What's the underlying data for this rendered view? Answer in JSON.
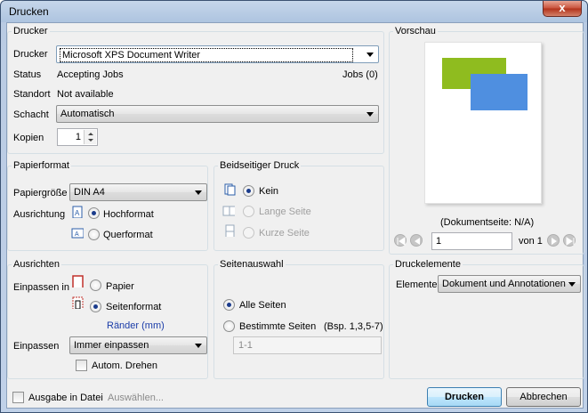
{
  "window": {
    "title": "Drucken",
    "close_label": "x"
  },
  "printer": {
    "group_title": "Drucker",
    "printer_label": "Drucker",
    "printer_value": "Microsoft XPS Document Writer",
    "status_label": "Status",
    "status_value": "Accepting Jobs",
    "jobs_text": "Jobs (0)",
    "location_label": "Standort",
    "location_value": "Not available",
    "tray_label": "Schacht",
    "tray_value": "Automatisch",
    "copies_label": "Kopien",
    "copies_value": "1"
  },
  "paper": {
    "group_title": "Papierformat",
    "size_label": "Papiergröße",
    "size_value": "DIN A4",
    "orientation_label": "Ausrichtung",
    "portrait_label": "Hochformat",
    "landscape_label": "Querformat"
  },
  "duplex": {
    "group_title": "Beidseitiger Druck",
    "none_label": "Kein",
    "long_label": "Lange Seite",
    "short_label": "Kurze Seite"
  },
  "preview": {
    "group_title": "Vorschau",
    "page_info": "(Dokumentseite: N/A)",
    "page_value": "1",
    "of_text": "von 1",
    "colors": {
      "green": "#8fbc1f",
      "blue": "#4f8fe0"
    }
  },
  "align": {
    "group_title": "Ausrichten",
    "fit_in_label": "Einpassen in",
    "paper_label": "Papier",
    "page_format_label": "Seitenformat",
    "margins_link": "Ränder (mm)",
    "fit_label": "Einpassen",
    "fit_value": "Immer einpassen",
    "auto_rotate_label": "Autom. Drehen"
  },
  "pages": {
    "group_title": "Seitenauswahl",
    "all_label": "Alle Seiten",
    "specific_label": "Bestimmte Seiten",
    "example_text": "(Bsp. 1,3,5-7)",
    "range_placeholder": "1-1"
  },
  "elements": {
    "group_title": "Druckelemente",
    "label": "Elemente",
    "value": "Dokument und Annotationen"
  },
  "footer": {
    "output_file_label": "Ausgabe in Datei",
    "choose_label": "Auswählen...",
    "print_button": "Drucken",
    "cancel_button": "Abbrechen"
  }
}
